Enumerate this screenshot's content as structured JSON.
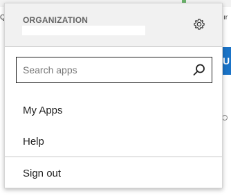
{
  "background": {
    "left_text": "Qu",
    "right_text": "ır",
    "blue_button_text": "U"
  },
  "header": {
    "org_label": "ORGANIZATION",
    "settings_icon": "gear-icon"
  },
  "search": {
    "placeholder": "Search apps",
    "value": "",
    "icon": "search-icon"
  },
  "menu": {
    "items": [
      {
        "label": "My Apps"
      },
      {
        "label": "Help"
      }
    ],
    "sign_out": "Sign out"
  },
  "colors": {
    "header_bg": "#f1f1f1",
    "accent_blue": "#1a73c7"
  }
}
